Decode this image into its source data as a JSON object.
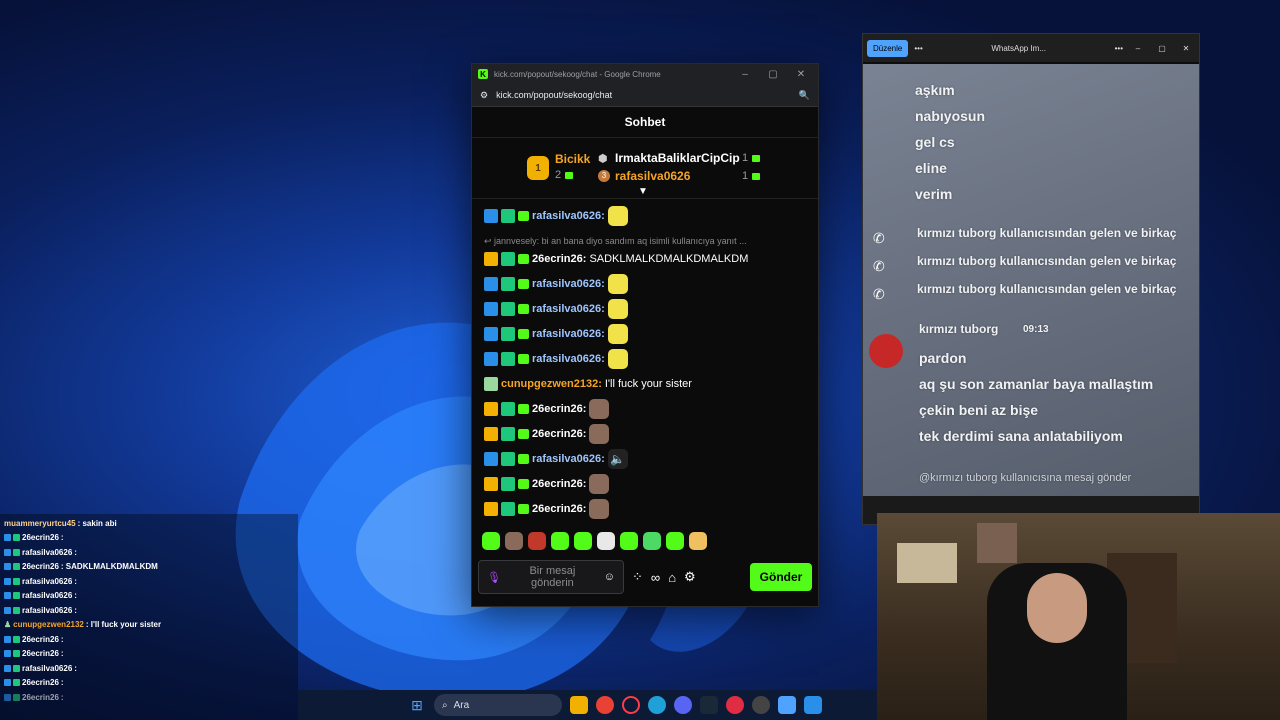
{
  "chrome": {
    "title": "kick.com/popout/sekoog/chat - Google Chrome",
    "url": "kick.com/popout/sekoog/chat",
    "minimize": "–",
    "maximize": "▢",
    "close": "✕"
  },
  "chat": {
    "header": "Sohbet",
    "leaderboard": {
      "first": {
        "rank": "1",
        "name": "Bicikk",
        "count": "2"
      },
      "second": {
        "name": "IrmaktaBaliklarCipCip",
        "count": "1"
      },
      "third": {
        "rank": "3",
        "name": "rafasilva0626",
        "count": "1"
      }
    },
    "reply_line": "jannvesely: bi an bana diyo sandım aq isimli kullanıcıya yanıt ...",
    "messages": [
      {
        "user": "rafasilva0626:",
        "text": "",
        "color": "#9ec6ff"
      },
      {
        "user": "26ecrin26:",
        "text": "SADKLMALKDMALKDMALKDM",
        "color": "#ffffff"
      },
      {
        "user": "rafasilva0626:",
        "text": "",
        "color": "#9ec6ff"
      },
      {
        "user": "rafasilva0626:",
        "text": "",
        "color": "#9ec6ff"
      },
      {
        "user": "rafasilva0626:",
        "text": "",
        "color": "#9ec6ff"
      },
      {
        "user": "rafasilva0626:",
        "text": "",
        "color": "#9ec6ff"
      },
      {
        "user": "cunupgezwen2132:",
        "text": "I'll fuck your sister",
        "color": "#f5a524"
      },
      {
        "user": "26ecrin26:",
        "text": "",
        "color": "#ffffff"
      },
      {
        "user": "26ecrin26:",
        "text": "",
        "color": "#ffffff"
      },
      {
        "user": "rafasilva0626:",
        "text": "",
        "color": "#9ec6ff"
      },
      {
        "user": "26ecrin26:",
        "text": "",
        "color": "#ffffff"
      },
      {
        "user": "26ecrin26:",
        "text": "",
        "color": "#ffffff"
      }
    ],
    "input_placeholder": "Bir mesaj gönderin",
    "send_label": "Gönder",
    "accent": "#53fc18"
  },
  "whatsapp": {
    "edit_label": "Düzenle",
    "title": "WhatsApp Im...",
    "lines": [
      "aşkım",
      "nabıyosun",
      "gel cs",
      "eline",
      "verim"
    ],
    "notice": "kırmızı tuborg kullanıcısından gelen ve birkaç",
    "sender": "kırmızı tuborg",
    "time": "09:13",
    "reply_lines": [
      "pardon",
      "aq şu son zamanlar baya mallaştım",
      "çekin beni az bişe",
      "tek derdimi sana anlatabiliyom"
    ],
    "composer": "@kırmızı tuborg kullanıcısına mesaj gönder"
  },
  "overlay": {
    "rows": [
      {
        "user": "muammeryurtcu45",
        "text": ": sakin abi"
      },
      {
        "user": "26ecrin26",
        "text": ":"
      },
      {
        "user": "rafasilva0626",
        "text": ":"
      },
      {
        "user": "26ecrin26",
        "text": ": SADKLMALKDMALKDM"
      },
      {
        "user": "rafasilva0626",
        "text": ":"
      },
      {
        "user": "rafasilva0626",
        "text": ":"
      },
      {
        "user": "rafasilva0626",
        "text": ":"
      },
      {
        "user": "cunupgezwen2132",
        "text": ": I'll fuck your sister"
      },
      {
        "user": "26ecrin26",
        "text": ":"
      },
      {
        "user": "26ecrin26",
        "text": ":"
      },
      {
        "user": "rafasilva0626",
        "text": ":"
      },
      {
        "user": "26ecrin26",
        "text": ":"
      },
      {
        "user": "26ecrin26",
        "text": ":"
      }
    ]
  },
  "taskbar": {
    "search_placeholder": "Ara"
  }
}
